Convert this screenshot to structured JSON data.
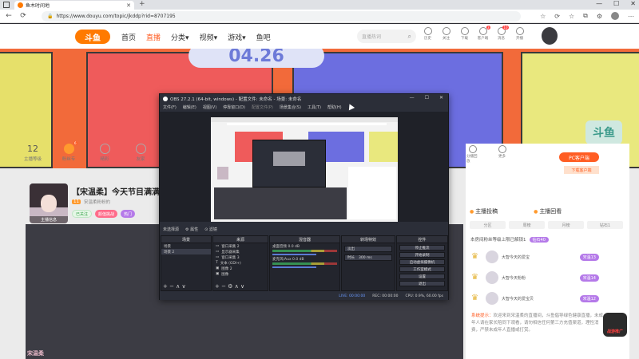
{
  "browser": {
    "tab_title": "鱼木时间地",
    "tab_close": "✕",
    "new_tab": "+",
    "url": "https://www.douyu.com/topic/jkddp?rid=8707195",
    "window_controls": [
      "—",
      "☐",
      "✕"
    ],
    "toolbar_icons": [
      "☆",
      "⟳",
      "☆",
      "⧉",
      "⚙",
      "⋯"
    ]
  },
  "navbar": {
    "logo": "斗鱼",
    "items": [
      {
        "label": "首页",
        "active": false
      },
      {
        "label": "直播",
        "active": true
      },
      {
        "label": "分类▾",
        "active": false
      },
      {
        "label": "视频▾",
        "active": false
      },
      {
        "label": "游戏▾",
        "active": false
      },
      {
        "label": "鱼吧",
        "active": false
      }
    ],
    "search_placeholder": "直播热词",
    "search_icon": "⌕",
    "top_icons": [
      {
        "label": "历史",
        "badge": ""
      },
      {
        "label": "关注",
        "badge": ""
      },
      {
        "label": "下载",
        "badge": ""
      },
      {
        "label": "客户端",
        "badge": "3"
      },
      {
        "label": "消息",
        "badge": "10"
      },
      {
        "label": "开播",
        "badge": ""
      }
    ]
  },
  "banner": {
    "title": "04.26"
  },
  "stats": [
    {
      "value": "12",
      "label": "主播等级",
      "orange": false,
      "badge": ""
    },
    {
      "value": "",
      "label": "粉丝专",
      "orange": true,
      "badge": "6"
    },
    {
      "value": "",
      "label": "精彩",
      "orange": false,
      "badge": ""
    },
    {
      "value": "",
      "label": "友家",
      "orange": false,
      "badge": ""
    }
  ],
  "streamer": {
    "avatar_tag": "主播信息",
    "room_title": "【宋温柔】今天节目满满",
    "level": "11",
    "name": "宋温柔粉粉的",
    "tags": [
      {
        "label": "已关注",
        "style": "green"
      },
      {
        "label": "颜值挑战",
        "style": "pink"
      },
      {
        "label": "热门",
        "style": "purple"
      }
    ],
    "watermark": "宋温柔"
  },
  "right_panel": {
    "top_icons": [
      {
        "label": "分播回放"
      },
      {
        "label": "更多"
      }
    ],
    "pc_button": "PC客户端",
    "download_label": "下载客户端",
    "tabs": [
      "主播投稿",
      "主播回看"
    ],
    "subtabs": [
      "分区",
      "周榜",
      "月榜",
      "钻石1"
    ],
    "rank_line": "本房间粉丝等级上限已解锁1",
    "rank_line_badge": "钻石40",
    "rank_rows": [
      {
        "name": "大智今天的爱宝",
        "level": "宋温13"
      },
      {
        "name": "大智今天粉粉",
        "level": "宋温14"
      },
      {
        "name": "大智今天的爱宝贝",
        "level": "宋温12"
      }
    ],
    "announce_prefix": "系统提示：",
    "announce_text": "欢迎来到宋温柔的直播间，斗鱼倡导绿色健康直播，未成年人请在家长陪同下观看，请勿相信任何第三方充值渠道，理性消费，严禁未成年人直播或打赏。",
    "mascot_label": "战游推广",
    "bottom_text": "欢迎来到本直播间"
  },
  "obs": {
    "title": "OBS 27.2.1 (64-bit, windows) - 配置文件: 未命名 - 场景: 未命名",
    "window_controls": [
      "—",
      "☐",
      "✕"
    ],
    "menu": [
      "文件(F)",
      "编辑(E)",
      "视图(V)",
      "停靠窗口(D)",
      "配置文件(P)",
      "场景集合(S)",
      "工具(T)",
      "帮助(H)"
    ],
    "scene_bar": [
      "未选择源",
      "⚙ 属性",
      "⊙ 滤镜"
    ],
    "docks": {
      "scenes": {
        "title": "场景",
        "items": [
          "场景",
          "场景 2"
        ],
        "foot": "+ − ∧ ∨"
      },
      "sources": {
        "title": "来源",
        "items": [
          "窗口采集 2",
          "显示器采集",
          "窗口采集 3",
          "文本 (GDI+)",
          "图像 2",
          "图像"
        ],
        "foot": "+ − ⚙ ∧ ∨"
      },
      "mixer": {
        "title": "混音器",
        "tracks": [
          "桌面音频",
          "麦克风/Aux"
        ],
        "values": [
          "0.0 dB",
          "0.0 dB"
        ]
      },
      "transitions": {
        "title": "转场特效",
        "type": "淡出",
        "duration_label": "时长",
        "duration": "300 ms"
      },
      "controls": {
        "title": "控件",
        "buttons": [
          "停止推流",
          "开始录制",
          "启动虚拟摄像机",
          "工作室模式",
          "设置",
          "退出"
        ]
      }
    },
    "status": {
      "live": "LIVE: 00:00:00",
      "rec": "REC: 00:00:00",
      "cpu": "CPU: 0.9%, 60.00 fps"
    }
  }
}
